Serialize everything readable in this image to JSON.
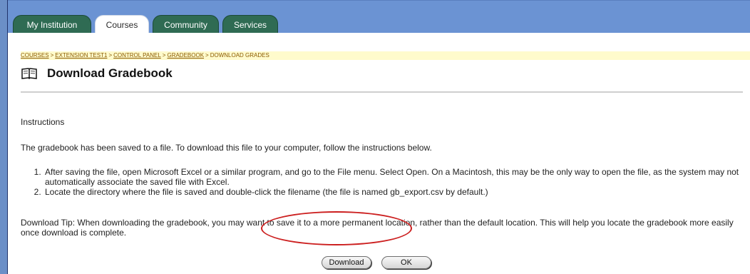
{
  "tabs": [
    {
      "label": "My Institution",
      "active": false
    },
    {
      "label": "Courses",
      "active": true
    },
    {
      "label": "Community",
      "active": false
    },
    {
      "label": "Services",
      "active": false
    }
  ],
  "breadcrumb": {
    "items": [
      "COURSES",
      "EXTENSION TEST1",
      "CONTROL PANEL",
      "GRADEBOOK"
    ],
    "current": "DOWNLOAD GRADES",
    "separator": ">"
  },
  "page": {
    "title": "Download Gradebook",
    "icon": "book-icon"
  },
  "instructions": {
    "heading": "Instructions",
    "intro": "The gradebook has been saved to a file. To download this file to your computer, follow the instructions below.",
    "steps": [
      "After saving the file, open Microsoft Excel or a similar program, and go to the File menu. Select Open. On a Macintosh, this may be the only way to open the file, as the system may not automatically associate the saved file with Excel.",
      "Locate the directory where the file is saved and double-click the filename (the file is named gb_export.csv by default.)"
    ],
    "tip": "Download Tip: When downloading the gradebook, you may want to save it to a more permanent location, rather than the default location. This will help you locate the gradebook more easily once download is complete."
  },
  "buttons": {
    "download": "Download",
    "ok": "OK"
  },
  "colors": {
    "tabbar": "#6b93d3",
    "tab_inactive": "#2f6b53",
    "breadcrumb_bg": "#fffbcc",
    "highlight": "#cc1f1f"
  }
}
